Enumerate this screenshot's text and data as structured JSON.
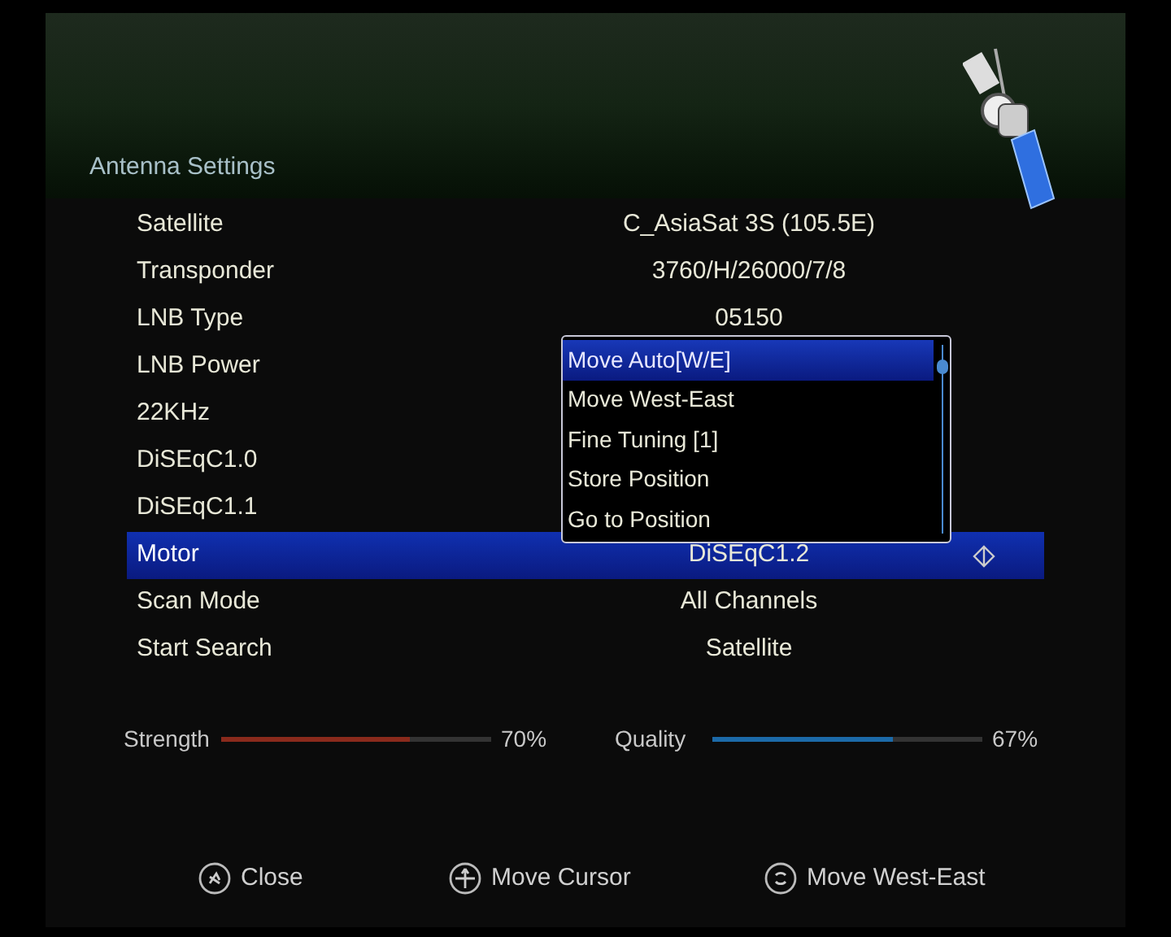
{
  "header": {
    "title": "Antenna Settings"
  },
  "settings": [
    {
      "label": "Satellite",
      "value": "C_AsiaSat 3S  (105.5E)",
      "selected": false
    },
    {
      "label": "Transponder",
      "value": "3760/H/26000/7/8",
      "selected": false
    },
    {
      "label": "LNB Type",
      "value": "05150",
      "selected": false
    },
    {
      "label": "LNB Power",
      "selected": false
    },
    {
      "label": "22KHz",
      "selected": false
    },
    {
      "label": "DiSEqC1.0",
      "selected": false
    },
    {
      "label": "DiSEqC1.1",
      "selected": false
    },
    {
      "label": "Motor",
      "value": "DiSEqC1.2",
      "selected": true
    },
    {
      "label": "Scan Mode",
      "value": "All Channels",
      "selected": false
    },
    {
      "label": "Start Search",
      "value": "Satellite",
      "selected": false
    }
  ],
  "popup": {
    "items": [
      {
        "label": "Move Auto[W/E]",
        "selected": true
      },
      {
        "label": "Move West-East",
        "selected": false
      },
      {
        "label": "Fine Tuning [1]",
        "selected": false
      },
      {
        "label": "Store Position",
        "selected": false
      },
      {
        "label": "Go to Position",
        "selected": false
      }
    ]
  },
  "meters": [
    {
      "kind": "strength",
      "label": "Strength",
      "level": 0.7,
      "reading": "70%"
    },
    {
      "kind": "quality",
      "label": "Quality",
      "level": 0.67,
      "reading": "67%"
    }
  ],
  "footer": [
    {
      "kind": "close",
      "label": "Close"
    },
    {
      "kind": "cursor",
      "label": "Move Cursor"
    },
    {
      "kind": "move",
      "label": "Move West-East"
    }
  ]
}
